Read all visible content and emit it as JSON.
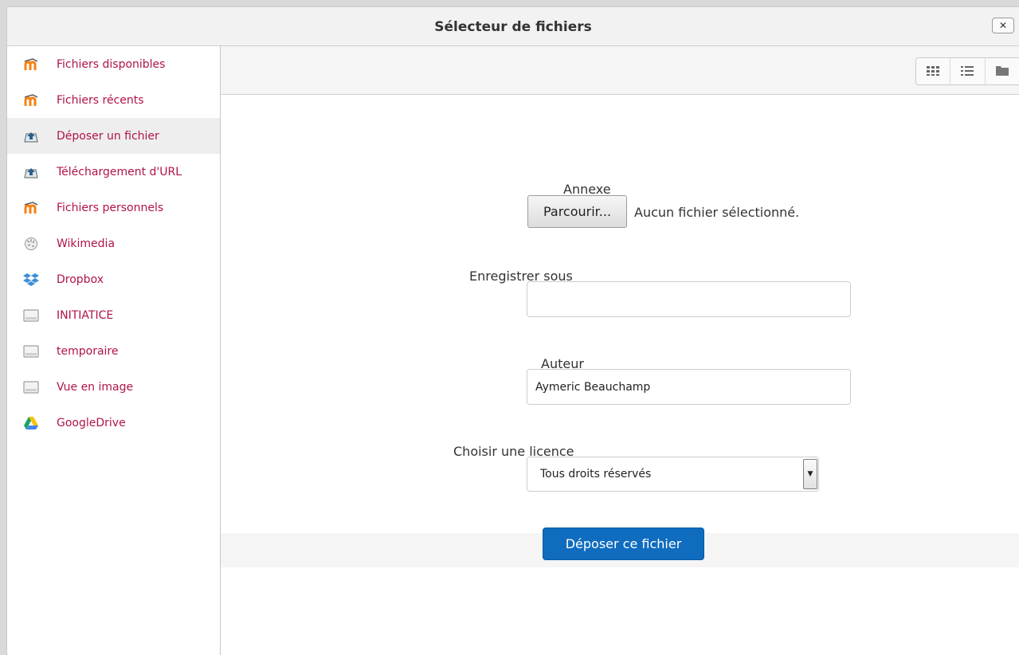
{
  "dialog": {
    "title": "Sélecteur de fichiers",
    "close_label": "✕"
  },
  "sidebar": {
    "items": [
      {
        "label": "Fichiers disponibles",
        "icon": "moodle-icon"
      },
      {
        "label": "Fichiers récents",
        "icon": "moodle-icon"
      },
      {
        "label": "Déposer un fichier",
        "icon": "upload-icon",
        "active": true
      },
      {
        "label": "Téléchargement d'URL",
        "icon": "upload-icon"
      },
      {
        "label": "Fichiers personnels",
        "icon": "moodle-icon"
      },
      {
        "label": "Wikimedia",
        "icon": "wikimedia-icon"
      },
      {
        "label": "Dropbox",
        "icon": "dropbox-icon"
      },
      {
        "label": "INITIATICE",
        "icon": "repository-icon"
      },
      {
        "label": "temporaire",
        "icon": "repository-icon"
      },
      {
        "label": "Vue en image",
        "icon": "repository-icon"
      },
      {
        "label": "GoogleDrive",
        "icon": "googledrive-icon"
      }
    ]
  },
  "toolbar": {
    "views": [
      "icons-view-icon",
      "list-view-icon",
      "tree-view-icon"
    ]
  },
  "form": {
    "attachment_label": "Annexe",
    "browse_label": "Parcourir...",
    "no_file_text": "Aucun fichier sélectionné.",
    "save_as_label": "Enregistrer sous",
    "save_as_value": "",
    "author_label": "Auteur",
    "author_value": "Aymeric Beauchamp",
    "license_label": "Choisir une licence",
    "license_value": "Tous droits réservés",
    "submit_label": "Déposer ce fichier"
  },
  "colors": {
    "link": "#b0134a",
    "primary": "#0f6cbf",
    "moodle_orange": "#f98012"
  }
}
